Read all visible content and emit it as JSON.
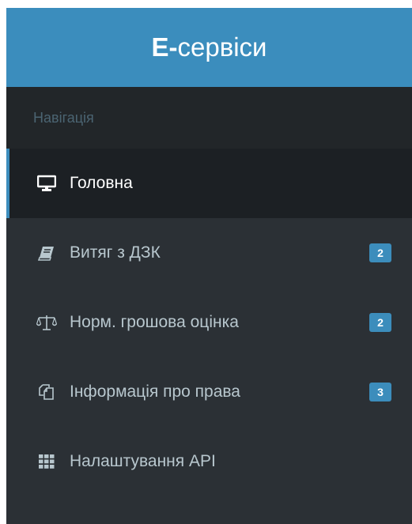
{
  "header": {
    "title_strong": "E-",
    "title_rest": "сервіси"
  },
  "nav": {
    "heading": "Навігація",
    "items": [
      {
        "label": "Головна",
        "icon": "monitor-icon",
        "badge": null,
        "active": true
      },
      {
        "label": "Витяг з ДЗК",
        "icon": "book-icon",
        "badge": "2",
        "active": false
      },
      {
        "label": "Норм. грошова оцінка",
        "icon": "scales-icon",
        "badge": "2",
        "active": false
      },
      {
        "label": "Інформація про права",
        "icon": "copy-documents-icon",
        "badge": "3",
        "active": false
      },
      {
        "label": "Налаштування API",
        "icon": "grid-icon",
        "badge": null,
        "active": false
      }
    ]
  },
  "colors": {
    "header_bg": "#3b8dbd",
    "sidebar_bg": "#2b3035",
    "active_bg": "#1c2024",
    "accent": "#3c8dbc",
    "text": "#b8c7ce"
  }
}
